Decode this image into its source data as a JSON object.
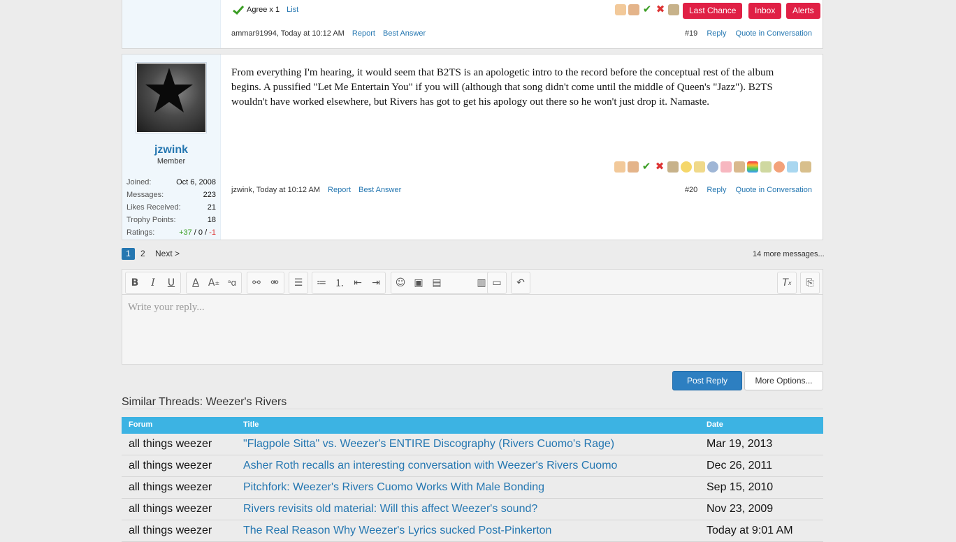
{
  "top_nav": {
    "last_chance": "Last Chance",
    "inbox": "Inbox",
    "alerts": "Alerts"
  },
  "post19": {
    "agree_text": "Agree x 1",
    "list_link": "List",
    "author_meta": "ammar91994, Today at 10:12 AM",
    "report": "Report",
    "best_answer": "Best Answer",
    "post_number": "#19",
    "reply": "Reply",
    "quote": "Quote in Conversation"
  },
  "post20": {
    "username": "jzwink",
    "user_title": "Member",
    "stats": [
      {
        "label": "Joined:",
        "value": "Oct 6, 2008"
      },
      {
        "label": "Messages:",
        "value": "223"
      },
      {
        "label": "Likes Received:",
        "value": "21"
      },
      {
        "label": "Trophy Points:",
        "value": "18"
      }
    ],
    "ratings_label": "Ratings:",
    "ratings_pos": "+37",
    "ratings_sep1": " / ",
    "ratings_neu": "0",
    "ratings_sep2": " / ",
    "ratings_neg": "-1",
    "message": "From everything I'm hearing, it would seem that B2TS is an apologetic intro to the record before the conceptual rest of the album begins. A pussified \"Let Me Entertain You\" if you will (although that song didn't come until the middle of Queen's \"Jazz\"). B2TS wouldn't have worked elsewhere, but Rivers has got to get his apology out there so he won't just drop it. Namaste.",
    "author_meta": "jzwink, Today at 10:12 AM",
    "report": "Report",
    "best_answer": "Best Answer",
    "post_number": "#20",
    "reply": "Reply",
    "quote": "Quote in Conversation"
  },
  "pagination": {
    "page1": "1",
    "page2": "2",
    "next": "Next >",
    "more": "14 more messages..."
  },
  "editor": {
    "placeholder": "Write your reply..."
  },
  "buttons": {
    "post_reply": "Post Reply",
    "more_options": "More Options..."
  },
  "similar": {
    "heading": "Similar Threads: Weezer's Rivers",
    "columns": {
      "forum": "Forum",
      "title": "Title",
      "date": "Date"
    },
    "rows": [
      {
        "forum": "all things weezer",
        "title": "\"Flagpole Sitta\" vs. Weezer's ENTIRE Discography (Rivers Cuomo's Rage)",
        "date": "Mar 19, 2013"
      },
      {
        "forum": "all things weezer",
        "title": "Asher Roth recalls an interesting conversation with Weezer's Rivers Cuomo",
        "date": "Dec 26, 2011"
      },
      {
        "forum": "all things weezer",
        "title": "Pitchfork: Weezer's Rivers Cuomo Works With Male Bonding",
        "date": "Sep 15, 2010"
      },
      {
        "forum": "all things weezer",
        "title": "Rivers revisits old material: Will this affect Weezer's sound?",
        "date": "Nov 23, 2009"
      },
      {
        "forum": "all things weezer",
        "title": "The Real Reason Why Weezer's Lyrics sucked Post-Pinkerton",
        "date": "Today at 9:01 AM"
      }
    ]
  },
  "colors": {
    "link": "#2577b1",
    "header_bg": "#3cb3e3",
    "alert_red": "#e02045",
    "primary_btn": "#2d7fc1"
  }
}
